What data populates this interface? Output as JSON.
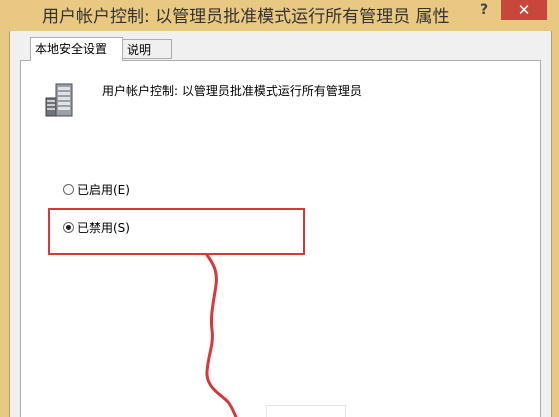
{
  "window": {
    "title": "用户帐户控制: 以管理员批准模式运行所有管理员 属性",
    "help_label": "?",
    "close_label": "✕"
  },
  "tabs": [
    {
      "label": "本地安全设置",
      "active": true
    },
    {
      "label": "说明",
      "active": false
    }
  ],
  "policy": {
    "icon": "server-icon",
    "title": "用户帐户控制: 以管理员批准模式运行所有管理员"
  },
  "options": [
    {
      "label": "已启用(E)",
      "checked": false
    },
    {
      "label": "已禁用(S)",
      "checked": true
    }
  ],
  "annotation": {
    "color": "#d9383a"
  },
  "colors": {
    "title_bar": "#e9c981",
    "close_button": "#c7473d"
  }
}
